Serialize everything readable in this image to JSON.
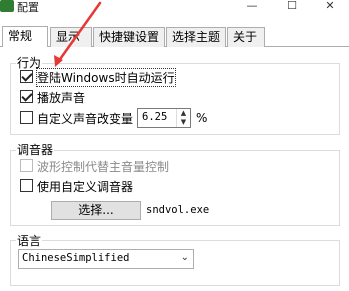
{
  "window": {
    "title": "配置",
    "minimize": "—",
    "maximize": "☐",
    "close": "✕"
  },
  "tabs": [
    {
      "label": "常规",
      "active": true
    },
    {
      "label": "显示",
      "active": false
    },
    {
      "label": "快捷键设置",
      "active": false
    },
    {
      "label": "选择主题",
      "active": false
    },
    {
      "label": "关于",
      "active": false
    }
  ],
  "behavior": {
    "title": "行为",
    "startup_label": "登陆Windows时自动运行",
    "startup_checked": true,
    "sound_label": "播放声音",
    "sound_checked": true,
    "custom_volume_label": "自定义声音改变量",
    "custom_volume_checked": false,
    "custom_volume_value": "6.25",
    "custom_volume_unit": "%"
  },
  "mixer": {
    "title": "调音器",
    "waveform_label": "波形控制代替主音量控制",
    "waveform_checked": false,
    "waveform_enabled": false,
    "custom_mixer_label": "使用自定义调音器",
    "custom_mixer_checked": false,
    "browse_button": "选择...",
    "mixer_path": "sndvol.exe"
  },
  "language": {
    "title": "语言",
    "selected": "ChineseSimplified"
  },
  "colors": {
    "annotation_arrow": "#e53935"
  }
}
